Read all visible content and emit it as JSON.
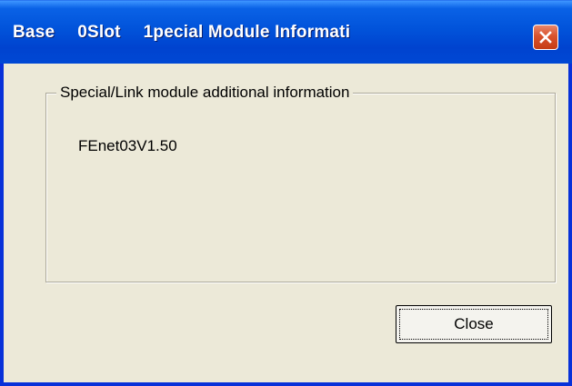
{
  "window": {
    "title_parts": [
      "Base",
      "0Slot",
      "1pecial Module Informati"
    ]
  },
  "groupbox": {
    "legend": "Special/Link module additional information",
    "module_info": "FEnet03V1.50"
  },
  "buttons": {
    "close_label": "Close"
  },
  "icons": {
    "titlebar_close": "close-x-icon"
  },
  "colors": {
    "titlebar": "#0153da",
    "window_bg": "#ece9d8",
    "close_button": "#d9522c"
  }
}
